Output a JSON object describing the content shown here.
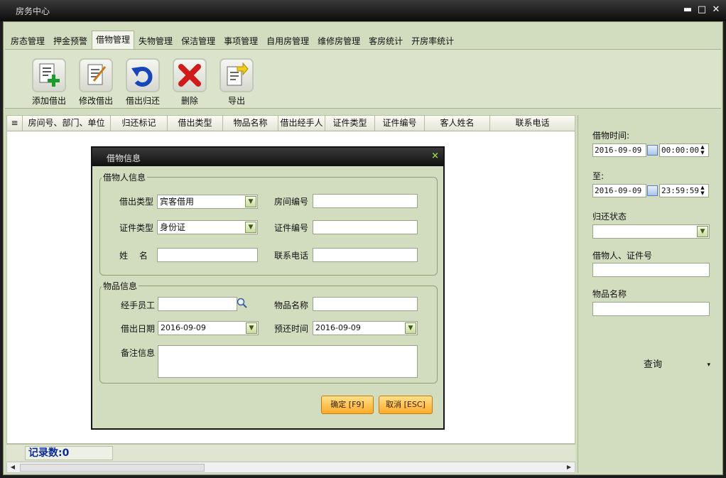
{
  "window": {
    "title": "房务中心",
    "minimize": "▬",
    "maximize": "□",
    "close": "✕"
  },
  "tabs": [
    "房态管理",
    "押金预警",
    "借物管理",
    "失物管理",
    "保洁管理",
    "事项管理",
    "自用房管理",
    "维修房管理",
    "客房统计",
    "开房率统计"
  ],
  "active_tab": "借物管理",
  "toolbar": {
    "add": "添加借出",
    "edit": "修改借出",
    "return": "借出归还",
    "delete": "删除",
    "export": "导出"
  },
  "grid": {
    "menu_icon": "≡",
    "columns": [
      "房间号、部门、单位",
      "归还标记",
      "借出类型",
      "物品名称",
      "借出经手人",
      "证件类型",
      "证件编号",
      "客人姓名",
      "联系电话"
    ]
  },
  "status": {
    "record_count": "记录数:0"
  },
  "scrollbar": {
    "left_arrow": "◀",
    "right_arrow": "▶"
  },
  "search_panel": {
    "borrow_time_label": "借物时间:",
    "from_date": "2016-09-09",
    "from_time": "00:00:00",
    "to_label": "至:",
    "to_date": "2016-09-09",
    "to_time": "23:59:59",
    "return_status_label": "归还状态",
    "return_status_value": "",
    "person_label": "借物人、证件号",
    "person_value": "",
    "item_label": "物品名称",
    "item_value": "",
    "query_button": "查询",
    "query_arrow": "▾"
  },
  "dialog": {
    "title": "借物信息",
    "close": "×",
    "borrower_group": "借物人信息",
    "lend_type_label": "借出类型",
    "lend_type_value": "宾客借用",
    "room_no_label": "房间编号",
    "room_no_value": "",
    "id_type_label": "证件类型",
    "id_type_value": "身份证",
    "id_no_label": "证件编号",
    "id_no_value": "",
    "name_label": "姓　 名",
    "name_value": "",
    "phone_label": "联系电话",
    "phone_value": "",
    "item_group": "物品信息",
    "handler_label": "经手员工",
    "handler_value": "",
    "item_name_label": "物品名称",
    "item_name_value": "",
    "lend_date_label": "借出日期",
    "lend_date_value": "2016-09-09",
    "return_time_label": "预还时间",
    "return_time_value": "2016-09-09",
    "note_label": "备注信息",
    "note_value": "",
    "confirm": "确定 [F9]",
    "cancel": "取消 [ESC]"
  }
}
